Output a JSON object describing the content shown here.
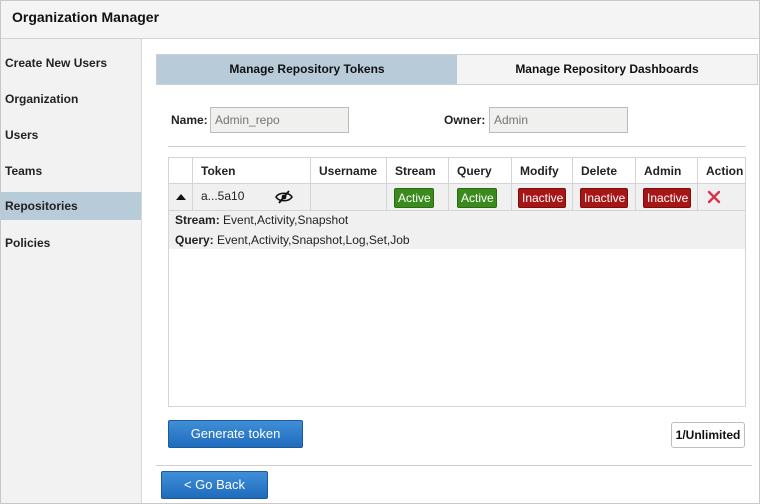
{
  "app": {
    "title": "Organization Manager"
  },
  "sidebar": {
    "items": [
      {
        "label": "Create New Users"
      },
      {
        "label": "Organization"
      },
      {
        "label": "Users"
      },
      {
        "label": "Teams"
      },
      {
        "label": "Repositories",
        "active": true
      },
      {
        "label": "Policies"
      }
    ]
  },
  "tabs": [
    {
      "label": "Manage Repository Tokens",
      "active": true
    },
    {
      "label": "Manage Repository Dashboards"
    }
  ],
  "form": {
    "name_label": "Name:",
    "name_placeholder": "Admin_repo",
    "owner_label": "Owner:",
    "owner_placeholder": "Admin"
  },
  "table": {
    "columns": [
      "Token",
      "Username",
      "Stream",
      "Query",
      "Modify",
      "Delete",
      "Admin",
      "Action"
    ],
    "rows": [
      {
        "expand_icon": "caret-up-icon",
        "token": "a...5a10",
        "visibility_icon": "eye-slash-icon",
        "username": "",
        "stream": "Active",
        "query": "Active",
        "modify": "Inactive",
        "delete": "Inactive",
        "admin": "Inactive",
        "action_icon": "delete-x-icon",
        "details": {
          "stream_label": "Stream:",
          "stream_value": " Event,Activity,Snapshot",
          "query_label": "Query:",
          "query_value": " Event,Activity,Snapshot,Log,Set,Job"
        }
      }
    ]
  },
  "buttons": {
    "generate_token": "Generate token",
    "go_back": "< Go Back"
  },
  "token_count": "1/Unlimited",
  "colors": {
    "active_green": "#3a8a1e",
    "inactive_red": "#a61616",
    "selected_bg": "#b8cbd8",
    "primary_blue": "#1f6bbd",
    "delete_x": "#d8344a"
  }
}
